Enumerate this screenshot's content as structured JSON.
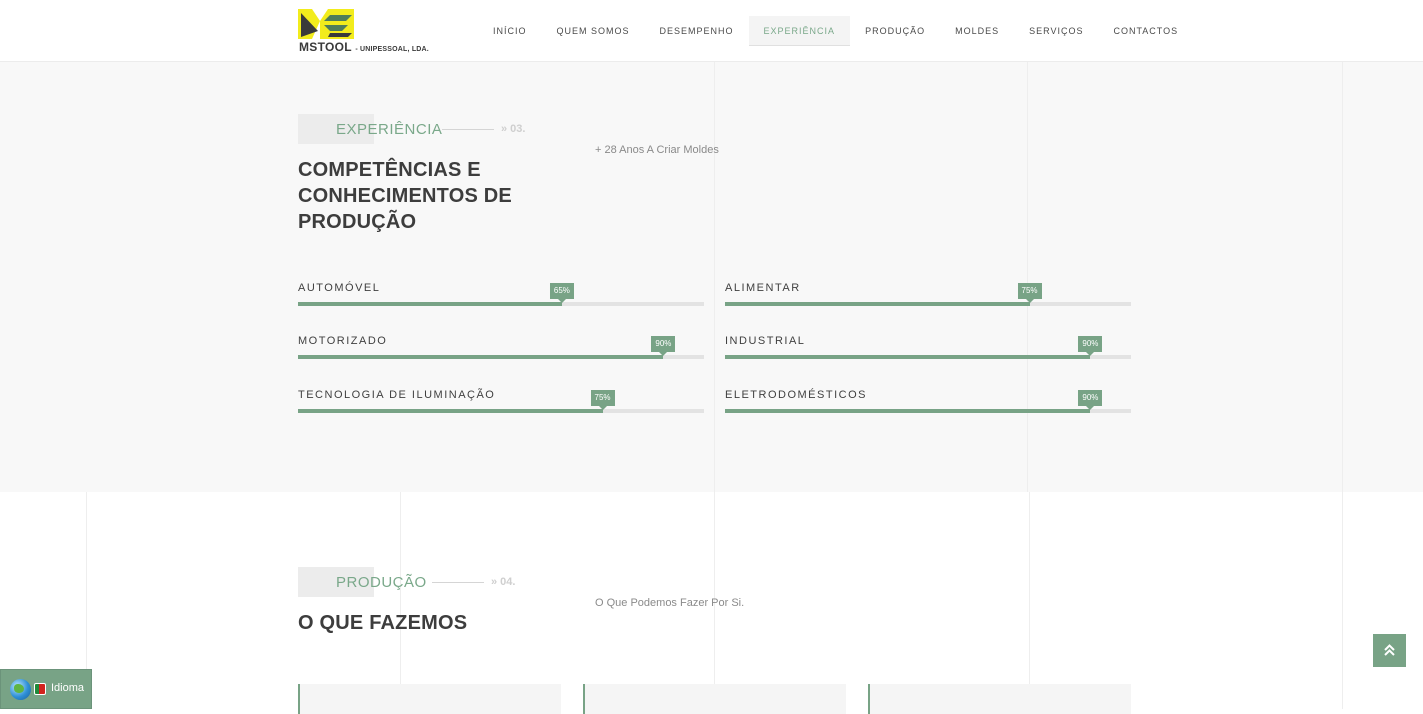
{
  "header": {
    "logo_text": "MSTOOL",
    "logo_subtext": "- UNIPESSOAL, LDA.",
    "nav": [
      {
        "label": "INÍCIO",
        "active": false
      },
      {
        "label": "QUEM SOMOS",
        "active": false
      },
      {
        "label": "DESEMPENHO",
        "active": false
      },
      {
        "label": "EXPERIÊNCIA",
        "active": true
      },
      {
        "label": "PRODUÇÃO",
        "active": false
      },
      {
        "label": "MOLDES",
        "active": false
      },
      {
        "label": "SERVIÇOS",
        "active": false
      },
      {
        "label": "CONTACTOS",
        "active": false
      }
    ]
  },
  "experiencia": {
    "tag": "EXPERIÊNCIA",
    "number": "» 03.",
    "title_line1": "COMPETÊNCIAS E",
    "title_line2": "CONHECIMENTOS DE",
    "title_line3": "PRODUÇÃO",
    "subtitle": "+ 28 Anos A Criar Moldes",
    "skills": [
      {
        "label": "AUTOMÓVEL",
        "percent": 65,
        "badge": "65%"
      },
      {
        "label": "ALIMENTAR",
        "percent": 75,
        "badge": "75%"
      },
      {
        "label": "MOTORIZADO",
        "percent": 90,
        "badge": "90%"
      },
      {
        "label": "INDUSTRIAL",
        "percent": 90,
        "badge": "90%"
      },
      {
        "label": "TECNOLOGIA DE ILUMINAÇÃO",
        "percent": 75,
        "badge": "75%"
      },
      {
        "label": "ELETRODOMÉSTICOS",
        "percent": 90,
        "badge": "90%"
      }
    ]
  },
  "producao": {
    "tag": "PRODUÇÃO",
    "number": "» 04.",
    "title": "O QUE FAZEMOS",
    "subtitle": "O Que Podemos Fazer Por Si."
  },
  "language_widget": {
    "label": "Idioma"
  },
  "colors": {
    "accent": "#78a386",
    "logo_yellow": "#f2ec1c",
    "logo_dark": "#3a3a3a"
  }
}
